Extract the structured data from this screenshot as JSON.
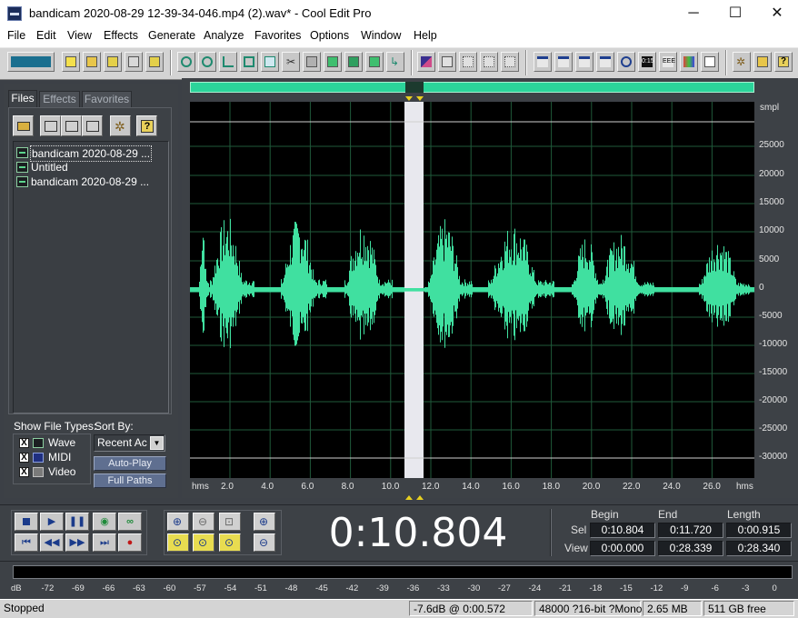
{
  "window": {
    "title": "bandicam 2020-08-29 12-39-34-046.mp4 (2).wav* - Cool Edit Pro",
    "minimize": "─",
    "maximize": "☐",
    "close": "✕"
  },
  "menu": [
    "File",
    "Edit",
    "View",
    "Effects",
    "Generate",
    "Analyze",
    "Favorites",
    "Options",
    "Window",
    "Help"
  ],
  "left_panel": {
    "tabs": [
      "Files",
      "Effects",
      "Favorites"
    ],
    "files": [
      "bandicam 2020-08-29 ...",
      "Untitled",
      "bandicam 2020-08-29 ..."
    ],
    "show_file_types_label": "Show File Types:",
    "sort_by_label": "Sort By:",
    "file_types": [
      {
        "label": "Wave",
        "checked": "X"
      },
      {
        "label": "MIDI",
        "checked": "X"
      },
      {
        "label": "Video",
        "checked": "X"
      }
    ],
    "sort_value": "Recent Ac",
    "auto_play": "Auto-Play",
    "full_paths": "Full Paths"
  },
  "waveform": {
    "unit": "smpl",
    "amp_labels": [
      "25000",
      "20000",
      "15000",
      "10000",
      "5000",
      "0",
      "-5000",
      "-10000",
      "-15000",
      "-20000",
      "-25000",
      "-30000"
    ],
    "time_labels": [
      "hms",
      "2.0",
      "4.0",
      "6.0",
      "8.0",
      "10.0",
      "12.0",
      "14.0",
      "16.0",
      "18.0",
      "20.0",
      "22.0",
      "24.0",
      "26.0",
      "hms"
    ],
    "wave_color": "#40e0a0",
    "selection_color": "#e8e8ee"
  },
  "transport": {
    "time": "0:10.804",
    "headers": [
      "Begin",
      "End",
      "Length"
    ],
    "sel_label": "Sel",
    "view_label": "View",
    "sel": [
      "0:10.804",
      "0:11.720",
      "0:00.915"
    ],
    "view": [
      "0:00.000",
      "0:28.339",
      "0:28.340"
    ]
  },
  "meter": {
    "labels": [
      "dB",
      "-72",
      "-69",
      "-66",
      "-63",
      "-60",
      "-57",
      "-54",
      "-51",
      "-48",
      "-45",
      "-42",
      "-39",
      "-36",
      "-33",
      "-30",
      "-27",
      "-24",
      "-21",
      "-18",
      "-15",
      "-12",
      "-9",
      "-6",
      "-3",
      "0"
    ]
  },
  "status": {
    "state": "Stopped",
    "level": "-7.6dB @  0:00.572",
    "format": "48000 ?16-bit ?Mono",
    "size": "2.65 MB",
    "free": "511 GB free"
  }
}
